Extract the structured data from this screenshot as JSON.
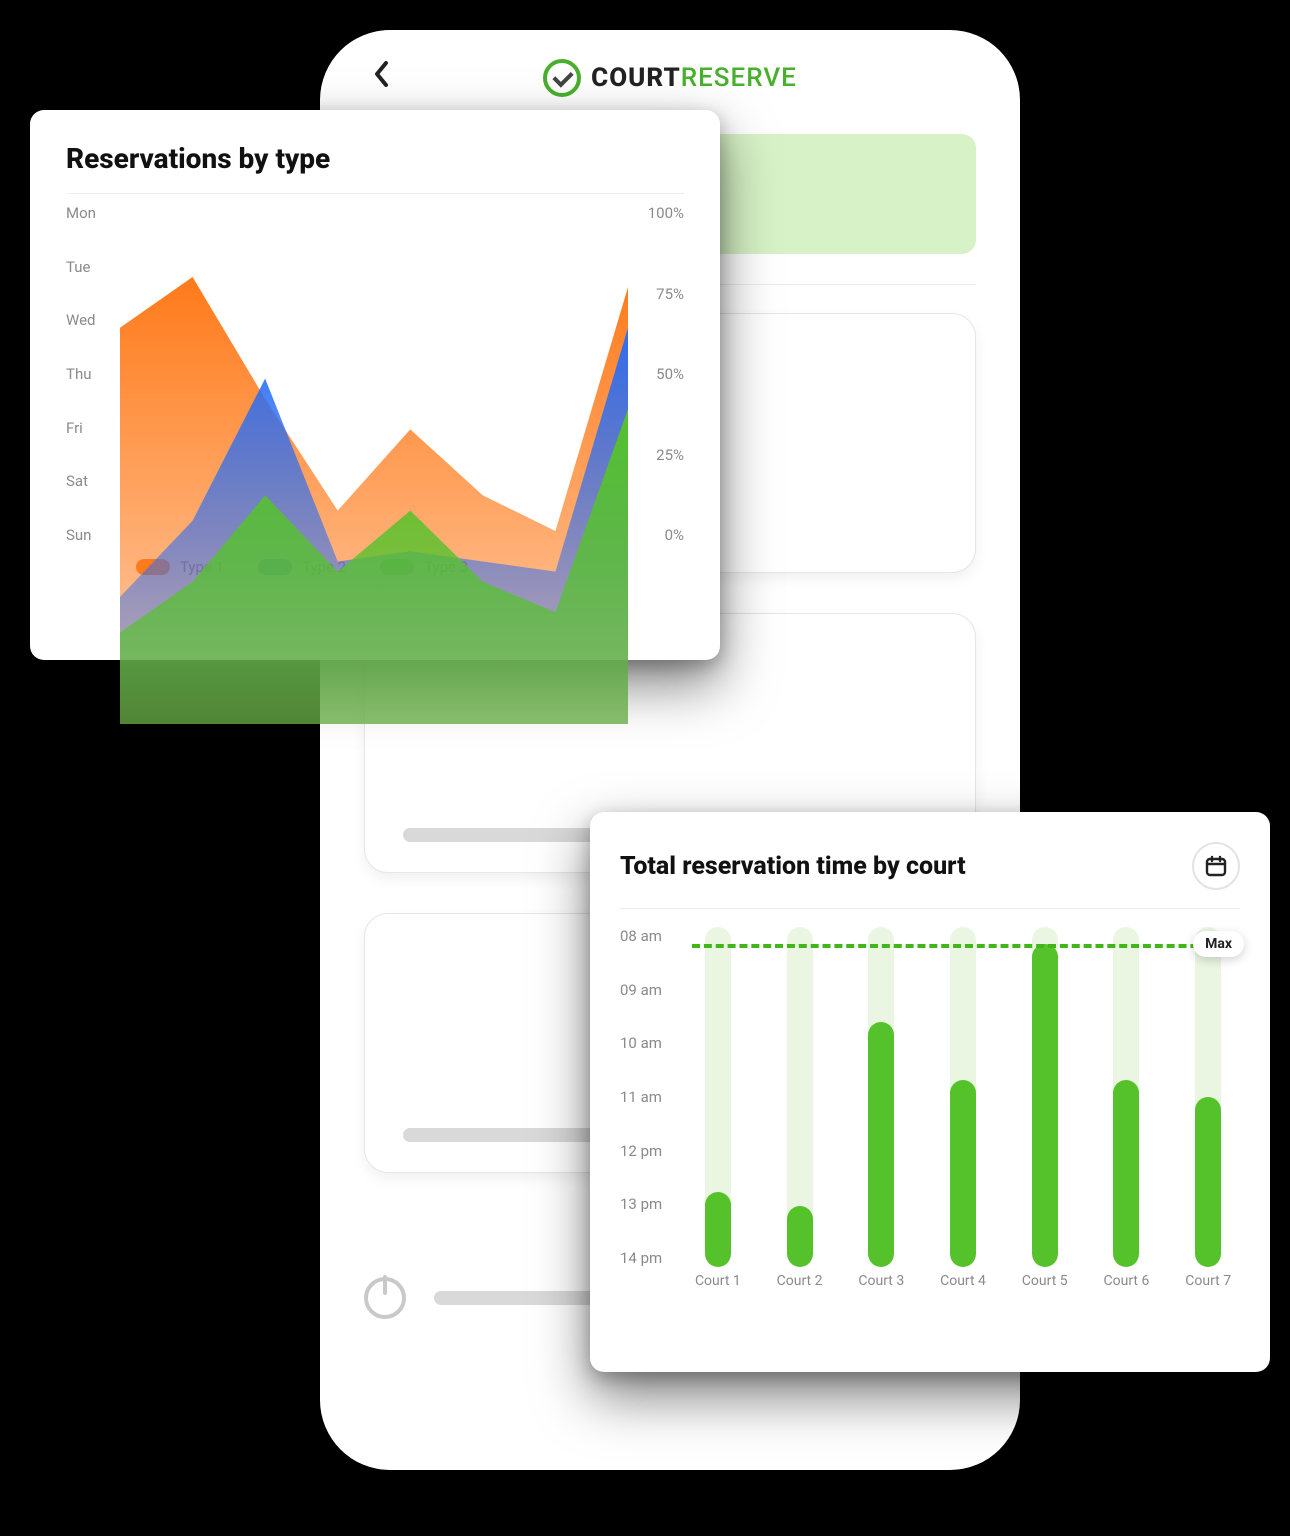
{
  "brand": {
    "primary": "COURT",
    "secondary": "RESERVE"
  },
  "colors": {
    "green": "#55c22c",
    "green_light": "#d7f2c6",
    "orange": "#ff7a1a",
    "blue": "#2a6df4"
  },
  "area_chart": {
    "title": "Reservations by type",
    "y_left_labels": [
      "Mon",
      "Tue",
      "Wed",
      "Thu",
      "Fri",
      "Sat",
      "Sun"
    ],
    "y_right_labels": [
      "100%",
      "75%",
      "50%",
      "25%",
      "0%"
    ],
    "legend": [
      {
        "label": "Type 1",
        "color": "#ff7a1a"
      },
      {
        "label": "Type 2",
        "color": "#2a6df4"
      },
      {
        "label": "Type 3",
        "color": "#55c22c"
      }
    ]
  },
  "bar_chart": {
    "title": "Total reservation time by court",
    "y_labels": [
      "08 am",
      "09 am",
      "10 am",
      "11 am",
      "12 pm",
      "13 pm",
      "14 pm"
    ],
    "max_label": "Max",
    "max_line_pct": 95,
    "courts": [
      "Court 1",
      "Court 2",
      "Court 3",
      "Court 4",
      "Court 5",
      "Court 6",
      "Court 7"
    ]
  },
  "chart_data": [
    {
      "type": "area",
      "title": "Reservations by type",
      "x": [
        0,
        1,
        2,
        3,
        4,
        5,
        6,
        7
      ],
      "xlabel": "",
      "ylabel": "",
      "ylim": [
        0,
        100
      ],
      "series": [
        {
          "name": "Type 1",
          "color": "#ff7a1a",
          "values": [
            78,
            88,
            64,
            42,
            58,
            45,
            38,
            86
          ]
        },
        {
          "name": "Type 2",
          "color": "#2a6df4",
          "values": [
            25,
            40,
            68,
            32,
            34,
            32,
            30,
            78
          ]
        },
        {
          "name": "Type 3",
          "color": "#55c22c",
          "values": [
            18,
            28,
            45,
            30,
            42,
            28,
            22,
            62
          ]
        }
      ],
      "left_axis_labels": [
        "Mon",
        "Tue",
        "Wed",
        "Thu",
        "Fri",
        "Sat",
        "Sun"
      ],
      "right_axis_ticks": [
        0,
        25,
        50,
        75,
        100
      ]
    },
    {
      "type": "bar",
      "title": "Total reservation time by court",
      "categories": [
        "Court 1",
        "Court 2",
        "Court 3",
        "Court 4",
        "Court 5",
        "Court 6",
        "Court 7"
      ],
      "values": [
        22,
        18,
        72,
        55,
        95,
        55,
        50
      ],
      "ylim": [
        0,
        100
      ],
      "y_tick_labels": [
        "08 am",
        "09 am",
        "10 am",
        "11 am",
        "12 pm",
        "13 pm",
        "14 pm"
      ],
      "annotations": [
        {
          "label": "Max",
          "y": 95
        }
      ]
    }
  ]
}
